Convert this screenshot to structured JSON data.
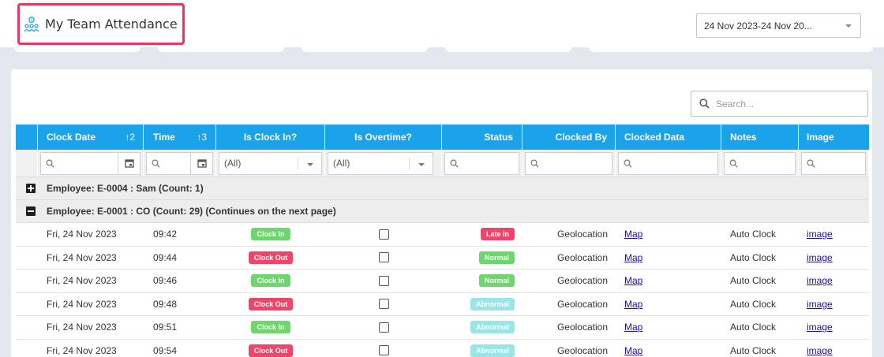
{
  "header": {
    "title": "My Team Attendance",
    "date_range": "24 Nov 2023-24 Nov 20..."
  },
  "search": {
    "placeholder": "Search..."
  },
  "columns": {
    "clock_date": "Clock Date",
    "clock_date_sort": "2",
    "time": "Time",
    "time_sort": "3",
    "is_clock_in": "Is Clock In?",
    "is_overtime": "Is Overtime?",
    "status": "Status",
    "clocked_by": "Clocked By",
    "clocked_data": "Clocked Data",
    "notes": "Notes",
    "image": "Image"
  },
  "filters": {
    "is_clock_in": "(All)",
    "is_overtime": "(All)"
  },
  "groups": [
    {
      "label": "Employee: E-0004 : Sam (Count: 1)",
      "expanded": false
    },
    {
      "label": "Employee: E-0001 : CO (Count: 29) (Continues on the next page)",
      "expanded": true
    }
  ],
  "rows": [
    {
      "date": "Fri, 24 Nov 2023",
      "time": "09:42",
      "clock": "Clock In",
      "status": "Late In",
      "clocked_by": "Geolocation",
      "data": "Map",
      "notes": "Auto Clock",
      "image": "image"
    },
    {
      "date": "Fri, 24 Nov 2023",
      "time": "09:44",
      "clock": "Clock Out",
      "status": "Normal",
      "clocked_by": "Geolocation",
      "data": "Map",
      "notes": "Auto Clock",
      "image": "image"
    },
    {
      "date": "Fri, 24 Nov 2023",
      "time": "09:46",
      "clock": "Clock In",
      "status": "Normal",
      "clocked_by": "Geolocation",
      "data": "Map",
      "notes": "Auto Clock",
      "image": "image"
    },
    {
      "date": "Fri, 24 Nov 2023",
      "time": "09:48",
      "clock": "Clock Out",
      "status": "Abnormal",
      "clocked_by": "Geolocation",
      "data": "Map",
      "notes": "Auto Clock",
      "image": "image"
    },
    {
      "date": "Fri, 24 Nov 2023",
      "time": "09:51",
      "clock": "Clock In",
      "status": "Abnormal",
      "clocked_by": "Geolocation",
      "data": "Map",
      "notes": "Auto Clock",
      "image": "image"
    },
    {
      "date": "Fri, 24 Nov 2023",
      "time": "09:54",
      "clock": "Clock Out",
      "status": "Abnormal",
      "clocked_by": "Geolocation",
      "data": "Map",
      "notes": "Auto Clock",
      "image": "image"
    }
  ],
  "colors": {
    "accent": "#1aa3e8",
    "highlight": "#e8365d",
    "clock_in": "#6dd66d",
    "clock_out": "#f0456b",
    "late_in": "#f0456b",
    "normal": "#6dd66d",
    "abnormal": "#99e6e6"
  }
}
